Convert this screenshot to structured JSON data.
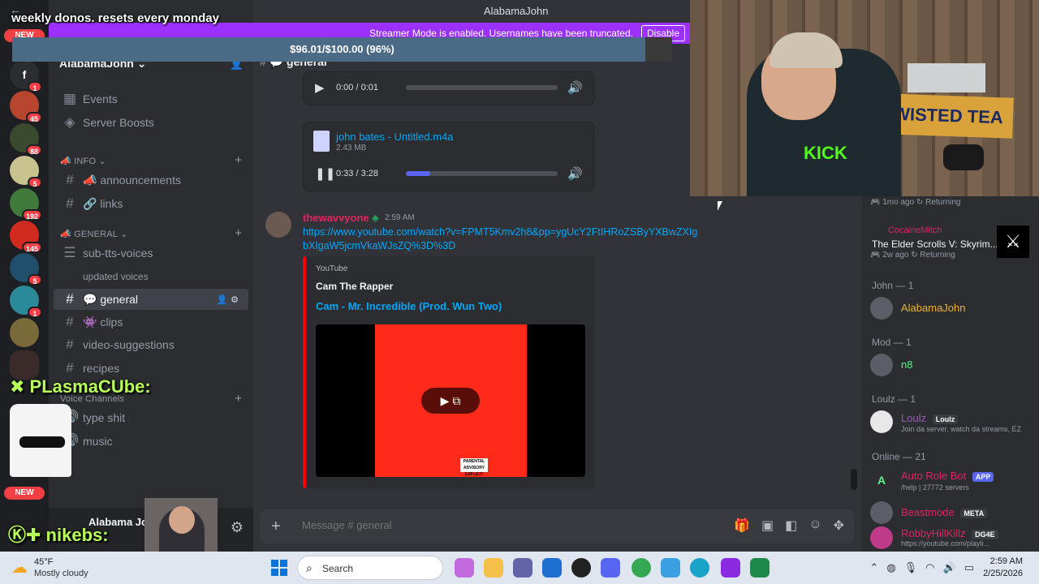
{
  "overlay": {
    "donos_text": "weekly donos. resets every monday",
    "progress_text": "$96.01/$100.00 (96%)",
    "progress_fraction": 0.96,
    "chat_line_1": "PLasmaCUbe:",
    "chat_line_2": "nikebs:",
    "cam_shirt_text": "KICK",
    "cam_banner_text": "WISTED TEA"
  },
  "window": {
    "title": "AlabamaJohn"
  },
  "streamer_mode": {
    "text": "Streamer Mode is enabled. Usernames have been truncated.",
    "disable_label": "Disable"
  },
  "rail": {
    "new_label": "NEW",
    "badges": [
      "1",
      "45",
      "88",
      "5",
      "192",
      "145",
      "5",
      "1"
    ]
  },
  "sidebar": {
    "guild_name": "AlabamaJohn",
    "events_label": "Events",
    "boosts_label": "Server Boosts",
    "cat_info": "INFO",
    "announcements": "announcements",
    "links": "links",
    "cat_general": "GENERAL",
    "sub_tts": "sub-tts-voices",
    "updated_voices": "updated voices",
    "general": "general",
    "clips": "clips",
    "video_suggestions": "video-suggestions",
    "recipes": "recipes",
    "cat_voice": "Voice Channels",
    "type_shit": "type shit",
    "music": "music"
  },
  "user_panel": {
    "name": "Alabama John"
  },
  "chat": {
    "header": "general",
    "audio1": {
      "time": "0:00 / 0:01",
      "progress": 0.0
    },
    "audio2": {
      "file_name": "john bates - Untitled.m4a",
      "file_size": "2.43 MB",
      "time": "0:33 / 3:28",
      "progress": 0.16
    },
    "message": {
      "author": "thewavvyone",
      "time": "2:59 AM",
      "link": "https://www.youtube.com/watch?v=FPMT5Kmv2h8&pp=ygUcY2FtIHRoZSByYXBwZXIgbXIgaW5jcmVkaWJsZQ%3D%3D",
      "embed_provider": "YouTube",
      "embed_author": "Cam The Rapper",
      "embed_title": "Cam - Mr. Incredible (Prod. Wun Two)",
      "advisory": "PARENTAL ADVISORY EXPLICIT CONTENT"
    },
    "composer_placeholder": "Message # general"
  },
  "members": {
    "top_activity_time": "1mo ago",
    "top_activity_status": "Returning",
    "activity_user": "CocaineMitch",
    "activity_game": "The Elder Scrolls V: Skyrim...",
    "activity_time": "2w ago",
    "activity_status": "Returning",
    "group_john": "John — 1",
    "john_member": "AlabamaJohn",
    "group_mod": "Mod — 1",
    "mod_member": "n8",
    "group_loulz": "Loulz — 1",
    "loulz_member": "Loulz",
    "loulz_tag": "Loulz",
    "loulz_status": "Join da server, watch da streams, EZ",
    "group_online": "Online — 21",
    "m1_name": "Auto Role Bot",
    "m1_tag": "APP",
    "m1_status": "/help | 27772 servers",
    "m2_name": "Beastmode",
    "m2_tag": "META",
    "m3_name": "RobbyHillKillz",
    "m3_tag": "DG4E",
    "m3_status": "https://youtube.com/playli..."
  },
  "taskbar": {
    "weather_temp": "45°F",
    "weather_desc": "Mostly cloudy",
    "search_label": "Search",
    "time": "2:59 AM",
    "date": "2/25/2026"
  },
  "colors": {
    "accent": "#5865f2",
    "streamer_bar": "#9b30ff",
    "link": "#00a8fc",
    "online": "#23a55a"
  }
}
